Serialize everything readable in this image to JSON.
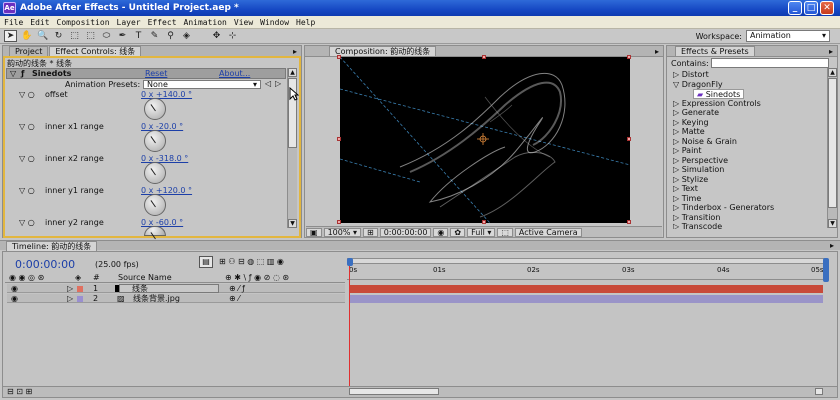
{
  "window": {
    "title": "Adobe After Effects - Untitled Project.aep *",
    "app_icon": "Ae",
    "minimize": "_",
    "maximize": "□",
    "close": "✕"
  },
  "menu": [
    "File",
    "Edit",
    "Composition",
    "Layer",
    "Effect",
    "Animation",
    "View",
    "Window",
    "Help"
  ],
  "tools": [
    "➤",
    "✋",
    "🔍",
    "↻",
    "⬚",
    "⬚",
    "⬭",
    "✒",
    "T",
    "✎",
    "⚲",
    "◈",
    "✥",
    "⊹"
  ],
  "workspace": {
    "label": "Workspace:",
    "value": "Animation"
  },
  "left_panel": {
    "tabs": [
      "Project",
      "Effect Controls: 线条"
    ],
    "breadcrumb": "韵动的线条 * 线条",
    "effect_name": "Sinedots",
    "reset": "Reset",
    "about": "About...",
    "presets_label": "Animation Presets:",
    "presets_value": "None",
    "params": [
      {
        "name": "offset",
        "value": "0 x +140.0 °"
      },
      {
        "name": "inner x1 range",
        "value": "0 x -20.0 °"
      },
      {
        "name": "inner x2 range",
        "value": "0 x -318.0 °"
      },
      {
        "name": "inner y1 range",
        "value": "0 x +120.0 °"
      },
      {
        "name": "inner y2 range",
        "value": "0 x -60.0 °"
      }
    ]
  },
  "comp_panel": {
    "tab": "Composition: 韵动的线条",
    "zoom": "100%",
    "timecode": "0:00:00:00",
    "resolution": "Full",
    "camera": "Active Camera"
  },
  "fx_panel": {
    "tab": "Effects & Presets",
    "contains_label": "Contains:",
    "items": [
      "▷ Distort",
      "▽ DragonFly",
      "Sinedots",
      "▷ Expression Controls",
      "▷ Generate",
      "▷ Keying",
      "▷ Matte",
      "▷ Noise & Grain",
      "▷ Paint",
      "▷ Perspective",
      "▷ Simulation",
      "▷ Stylize",
      "▷ Text",
      "▷ Time",
      "▷ Tinderbox - Generators",
      "▷ Transition",
      "▷ Transcode"
    ]
  },
  "timeline": {
    "tab": "Timeline: 韵动的线条",
    "timecode": "0:00:00:00",
    "fps": "(25.00 fps)",
    "col_num": "#",
    "col_source": "Source Name",
    "ruler": [
      "0s",
      "01s",
      "02s",
      "03s",
      "04s",
      "05s"
    ],
    "layers": [
      {
        "num": "1",
        "name": "线条",
        "color": "#e07060",
        "bar": "#c84a3a"
      },
      {
        "num": "2",
        "name": "线条背景.jpg",
        "color": "#9a8fd0",
        "bar": "#9a94c8"
      }
    ]
  },
  "colors": {
    "accent_frame": "#e2b63f",
    "timeline_cursor": "#e03030",
    "layer1": "#c84a3a",
    "layer2": "#9a94c8"
  }
}
